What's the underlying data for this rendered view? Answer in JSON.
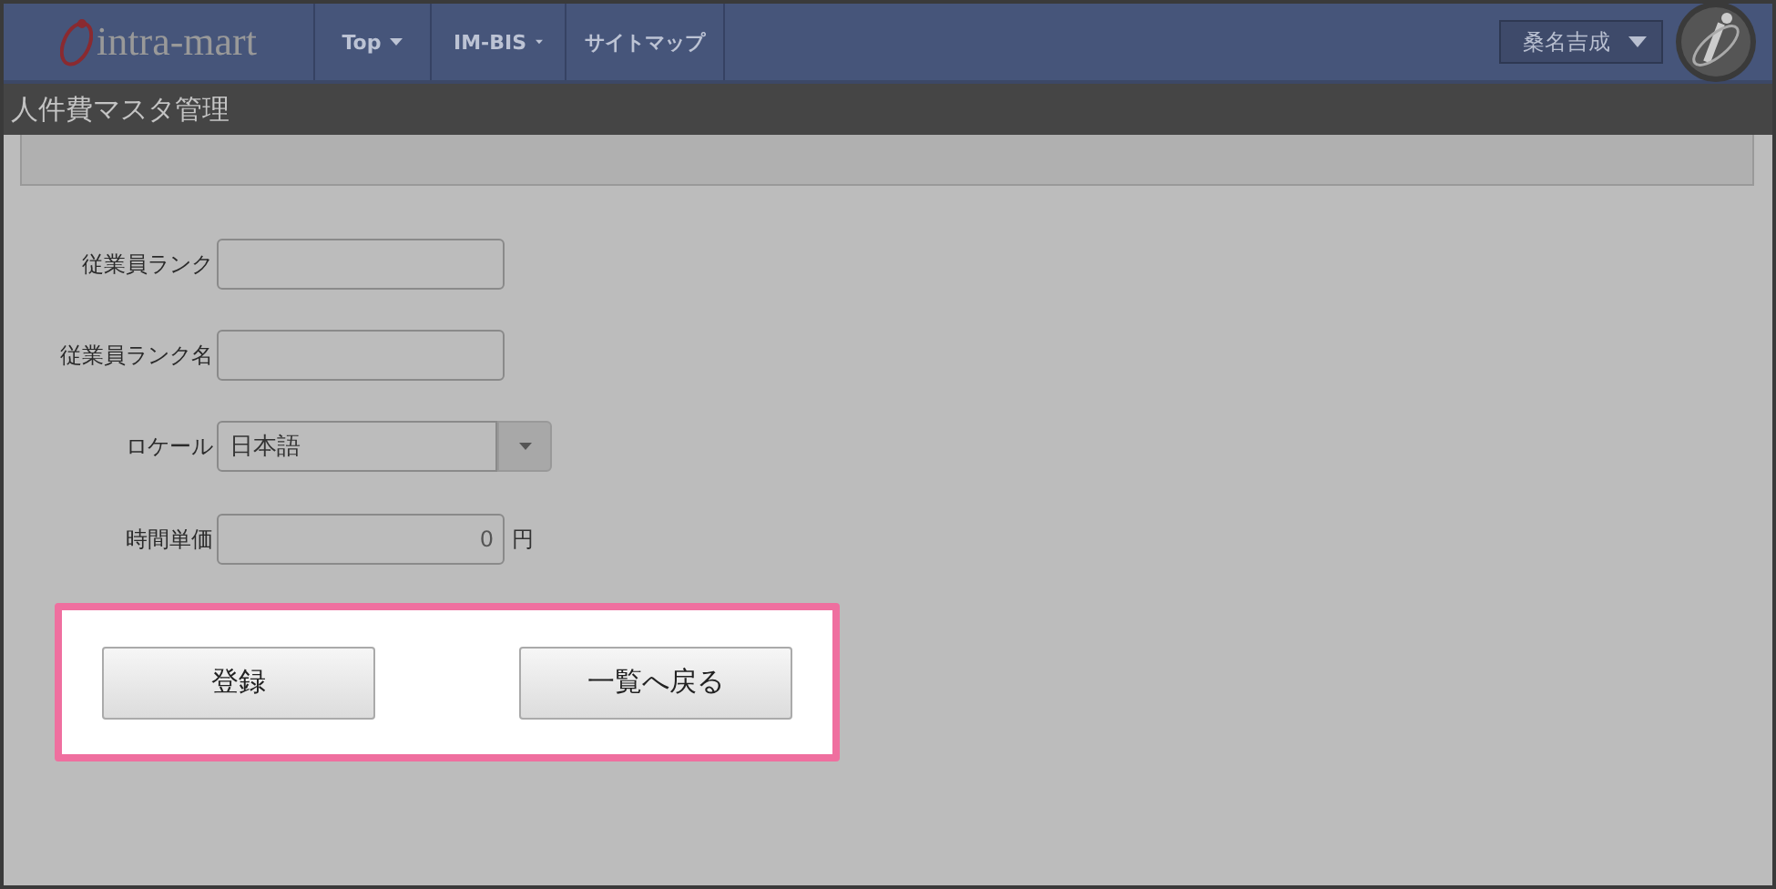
{
  "header": {
    "logo": "intra-mart",
    "menu": [
      {
        "label": "Top",
        "dropdown": true
      },
      {
        "label": "IM-BIS",
        "dropdown": true
      },
      {
        "label": "サイトマップ",
        "dropdown": false
      }
    ],
    "user": "桑名吉成"
  },
  "page_title": "人件費マスタ管理",
  "form": [
    {
      "kind": "text",
      "label": "従業員ランク"
    },
    {
      "kind": "text",
      "label": "従業員ランク名"
    },
    {
      "kind": "select",
      "label": "ロケール",
      "value": "日本語"
    },
    {
      "kind": "number",
      "label": "時間単価",
      "value": "0",
      "unit": "円"
    }
  ],
  "buttons": [
    "登録",
    "一覧へ戻る"
  ]
}
